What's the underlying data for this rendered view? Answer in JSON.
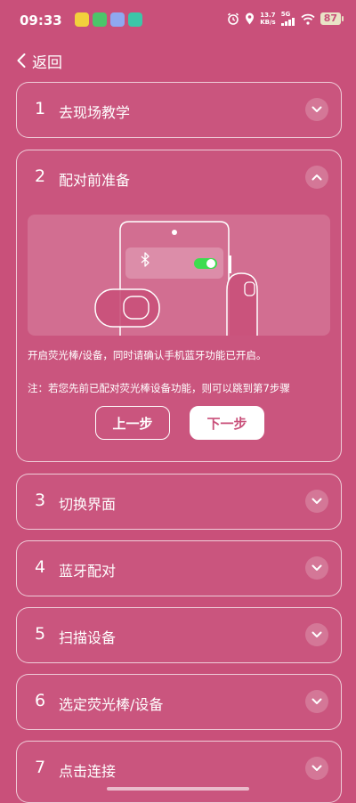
{
  "status_bar": {
    "time": "09:33",
    "net_speed_value": "13.7",
    "net_speed_unit": "KB/s",
    "network_type": "5G",
    "battery": "87",
    "app_icons": [
      "yellow-app-icon",
      "green-app-icon",
      "blue-app-icon",
      "teal-app-icon"
    ]
  },
  "nav": {
    "back_label": "返回"
  },
  "steps": [
    {
      "num": "1",
      "title": "去现场教学",
      "expanded": false
    },
    {
      "num": "2",
      "title": "配对前准备",
      "expanded": true
    },
    {
      "num": "3",
      "title": "切换界面",
      "expanded": false
    },
    {
      "num": "4",
      "title": "蓝牙配对",
      "expanded": false
    },
    {
      "num": "5",
      "title": "扫描设备",
      "expanded": false
    },
    {
      "num": "6",
      "title": "选定荧光棒/设备",
      "expanded": false
    },
    {
      "num": "7",
      "title": "点击连接",
      "expanded": false
    }
  ],
  "step2": {
    "description": "开启荧光棒/设备，同时请确认手机蓝牙功能已开启。",
    "note": "注：若您先前已配对荧光棒设备功能，则可以跳到第7步骤",
    "prev_label": "上一步",
    "next_label": "下一步",
    "bluetooth_toggle_on": true
  },
  "colors": {
    "background": "#c9507a",
    "toggle_on": "#3ddc4f",
    "battery": "#e9e3c6"
  }
}
